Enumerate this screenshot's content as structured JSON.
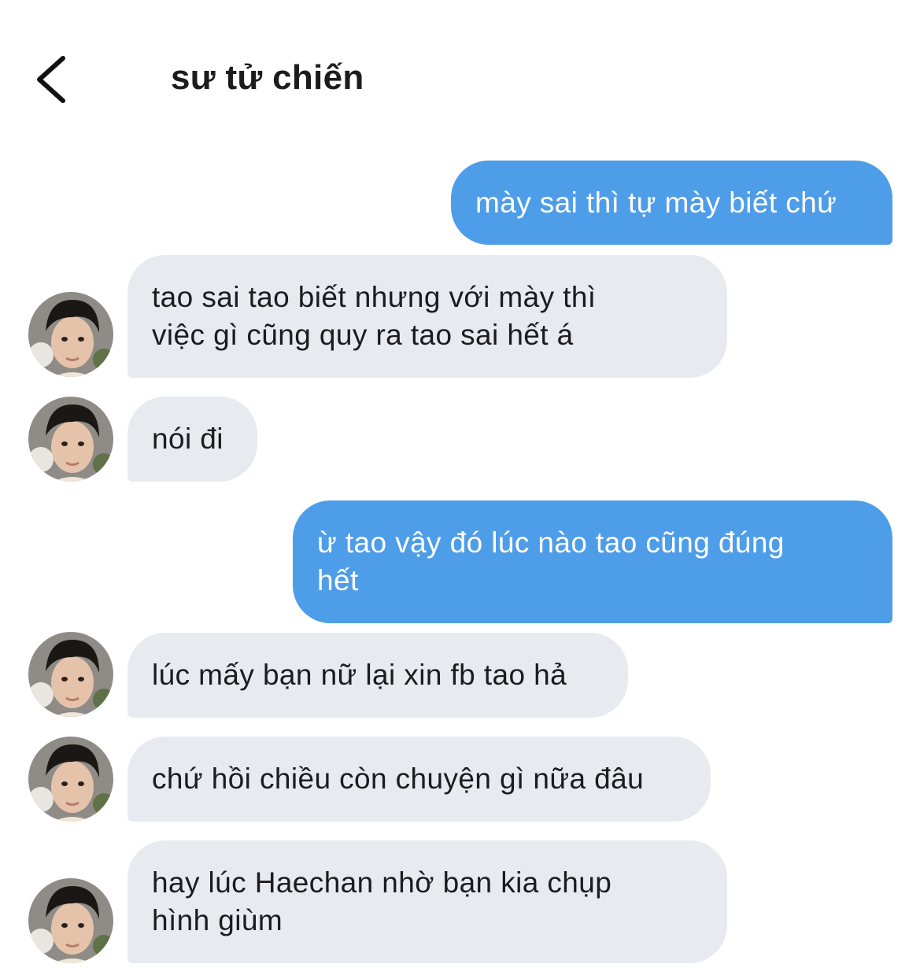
{
  "header": {
    "title": "sư tử chiến",
    "back_icon": "chevron-left-icon"
  },
  "colors": {
    "sent_bubble": "#4e9de8",
    "received_bubble": "#e7eaee",
    "text_dark": "#1c1c1e",
    "text_light": "#ffffff"
  },
  "messages": [
    {
      "direction": "sent",
      "lines": [
        "mày sai thì tự mày biết chứ"
      ]
    },
    {
      "direction": "received",
      "lines": [
        "tao sai tao biết nhưng với mày thì",
        "việc gì cũng quy ra tao sai hết á"
      ],
      "avatar": "avatar-icon"
    },
    {
      "direction": "received",
      "lines": [
        "nói đi"
      ],
      "avatar": "avatar-icon"
    },
    {
      "direction": "sent",
      "lines": [
        "ừ tao vậy đó lúc nào tao cũng đúng",
        "hết"
      ]
    },
    {
      "direction": "received",
      "lines": [
        "lúc mấy bạn nữ lại xin fb tao hả"
      ],
      "avatar": "avatar-icon"
    },
    {
      "direction": "received",
      "lines": [
        "chứ hồi chiều còn chuyện gì nữa đâu"
      ],
      "avatar": "avatar-icon"
    },
    {
      "direction": "received",
      "lines": [
        "hay lúc Haechan nhờ bạn kia chụp",
        "hình giùm"
      ],
      "avatar": "avatar-icon"
    }
  ]
}
